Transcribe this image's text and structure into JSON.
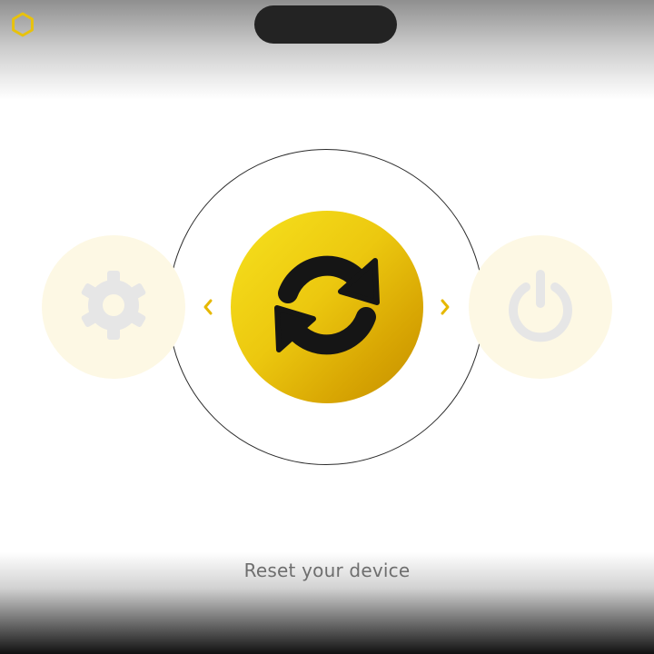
{
  "header": {
    "logo_icon": "hexagon-outline-icon",
    "logo_color": "#e8c20c"
  },
  "carousel": {
    "items": [
      {
        "icon": "gear-icon",
        "state": "inactive"
      },
      {
        "icon": "sync-refresh-icon",
        "state": "selected"
      },
      {
        "icon": "power-icon",
        "state": "inactive"
      }
    ],
    "prev_icon": "chevron-left-icon",
    "next_icon": "chevron-right-icon"
  },
  "caption": "Reset your device",
  "colors": {
    "accent": "#f2d418",
    "accent_dark": "#c48e00",
    "inactive_bg": "#fdf8e4",
    "inactive_icon": "#e6e6e6",
    "icon_dark": "#151515",
    "caption_text": "#6e6e6e"
  }
}
